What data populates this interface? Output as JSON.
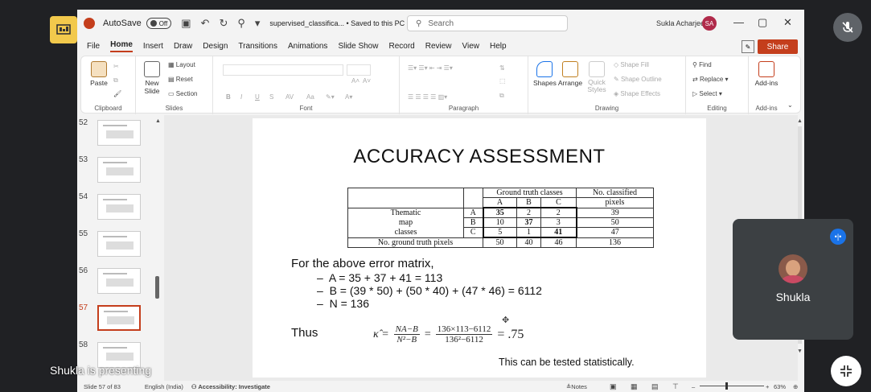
{
  "titlebar": {
    "autosave_label": "AutoSave",
    "autosave_state": "Off",
    "doc_title": "supervised_classifica... • Saved to this PC",
    "search_placeholder": "Search",
    "user_name": "Sukla Acharjee",
    "user_initials": "SA"
  },
  "menu": [
    "File",
    "Home",
    "Insert",
    "Draw",
    "Design",
    "Transitions",
    "Animations",
    "Slide Show",
    "Record",
    "Review",
    "View",
    "Help"
  ],
  "share_label": "Share",
  "ribbon": {
    "clipboard": {
      "paste": "Paste",
      "label": "Clipboard"
    },
    "slides": {
      "new_slide": "New Slide",
      "layout": "Layout",
      "reset": "Reset",
      "section": "Section",
      "label": "Slides"
    },
    "font": {
      "bold": "B",
      "italic": "I",
      "underline": "U",
      "strike": "S",
      "label": "Font",
      "size_up": "A˄",
      "size_down": "A˅",
      "case": "Aa",
      "spacing": "AV"
    },
    "paragraph": {
      "label": "Paragraph"
    },
    "drawing": {
      "shapes": "Shapes",
      "arrange": "Arrange",
      "quick_styles": "Quick Styles",
      "shape_fill": "Shape Fill",
      "shape_outline": "Shape Outline",
      "shape_effects": "Shape Effects",
      "label": "Drawing"
    },
    "editing": {
      "find": "Find",
      "replace": "Replace",
      "select": "Select",
      "label": "Editing"
    },
    "addins": {
      "addins": "Add-ins",
      "label": "Add-ins"
    }
  },
  "thumbnails": [
    {
      "num": "52",
      "selected": false
    },
    {
      "num": "53",
      "selected": false
    },
    {
      "num": "54",
      "selected": false
    },
    {
      "num": "55",
      "selected": false
    },
    {
      "num": "56",
      "selected": false
    },
    {
      "num": "57",
      "selected": true
    },
    {
      "num": "58",
      "selected": false
    }
  ],
  "slide": {
    "title": "ACCURACY ASSESSMENT",
    "table": {
      "gt_header": "Ground truth classes",
      "no_classified": "No. classified",
      "pixels": "pixels",
      "cols": [
        "A",
        "B",
        "C"
      ],
      "row_label_lines": [
        "Thematic",
        "map",
        "classes"
      ],
      "rows": [
        {
          "class": "A",
          "values": [
            "35",
            "2",
            "2"
          ],
          "total": "39"
        },
        {
          "class": "B",
          "values": [
            "10",
            "37",
            "3"
          ],
          "total": "50"
        },
        {
          "class": "C",
          "values": [
            "5",
            "1",
            "41"
          ],
          "total": "47"
        }
      ],
      "footer_label": "No. ground truth pixels",
      "footer_values": [
        "50",
        "40",
        "46"
      ],
      "footer_total": "136"
    },
    "for_text": "For the above error matrix,",
    "bullets": [
      "A = 35 + 37 + 41 = 113",
      "B = (39 * 50) + (50 * 40) + (47 * 46) = 6112",
      "N = 136"
    ],
    "bullet_dash": "–",
    "thus": "Thus",
    "kappa_symbol": "κ̂ =",
    "frac1_num": "NA−B",
    "frac1_den": "N²−B",
    "frac2_num": "136×113−6112",
    "frac2_den": "136²−6112",
    "result": "= .75",
    "eq": "=",
    "statistic_note": "This can be tested statistically."
  },
  "status": {
    "slide_info": "Slide 57 of 83",
    "language": "English (India)",
    "accessibility": "Accessibility: Investigate",
    "notes": "Notes",
    "zoom": "63%"
  },
  "meet": {
    "participant_name": "Shukla",
    "presenting_text": "Shukla is presenting"
  }
}
